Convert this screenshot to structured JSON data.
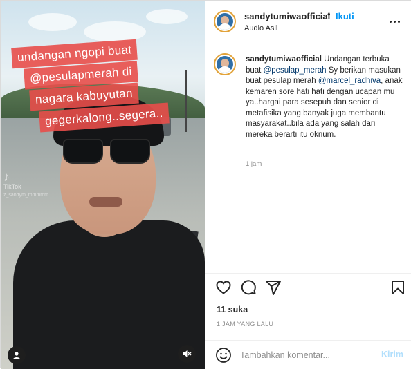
{
  "post": {
    "media": {
      "caption_lines": [
        "undangan ngopi buat",
        "@pesulapmerah di",
        "nagara kabuyutan",
        "gegerkalong..segera.."
      ],
      "watermark_brand": "TikTok",
      "watermark_handle": "z_sandym_mmmmm",
      "icons": {
        "user_tag": "person-icon",
        "mute": "speaker-muted-icon"
      }
    },
    "header": {
      "username": "sandytumiwaofficial",
      "separator": "•",
      "follow_label": "Ikuti",
      "audio_label": "Audio Asli",
      "more_icon": "more-options-icon"
    },
    "comment": {
      "username": "sandytumiwaofficial",
      "text_1": " Undangan terbuka buat ",
      "mention_1": "@pesulap_merah",
      "text_2": " Sy berikan masukan buat pesulap merah ",
      "mention_2": "@marcel_radhiva",
      "text_3": ", anak kemaren sore hati hati dengan ucapan mu ya..hargai para sesepuh dan senior di metafisika yang banyak juga membantu masyarakat..bila ada yang salah dari mereka berarti itu oknum.",
      "time": "1 jam"
    },
    "actions": {
      "like_icon": "heart-icon",
      "comment_icon": "comment-bubble-icon",
      "share_icon": "paper-plane-icon",
      "save_icon": "bookmark-icon"
    },
    "likes_label": "11 suka",
    "posted_ago": "1 JAM YANG LALU",
    "composer": {
      "emoji_icon": "smiley-icon",
      "placeholder": "Tambahkan komentar...",
      "value": "",
      "post_label": "Kirim"
    },
    "colors": {
      "follow": "#0095f6",
      "mention": "#00376b",
      "post_disabled": "#b2dffc",
      "caption_bg": "#e84e4a",
      "story_ring": "#e2a33a"
    }
  }
}
